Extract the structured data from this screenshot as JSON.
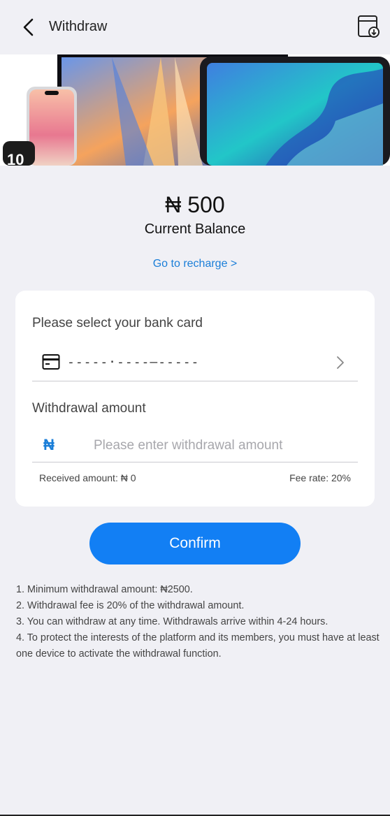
{
  "header": {
    "title": "Withdraw"
  },
  "balance": {
    "amount": "₦ 500",
    "label": "Current Balance"
  },
  "recharge_link": "Go to recharge >",
  "bank": {
    "section_label": "Please select your bank card",
    "card_number_masked": "-----·----—-----"
  },
  "withdrawal": {
    "section_label": "Withdrawal amount",
    "currency_symbol": "₦",
    "input_value": "",
    "input_placeholder": "Please enter withdrawal amount",
    "received_amount": "Received amount: ₦ 0",
    "fee_rate": "Fee rate: 20%"
  },
  "confirm_label": "Confirm",
  "notes": [
    "1. Minimum withdrawal amount: ₦2500.",
    "2. Withdrawal fee is 20% of the withdrawal amount.",
    "3. You can withdraw at any time. Withdrawals arrive within 4-24 hours.",
    "4. To protect the interests of the platform and its members, you must have at least one device to activate the withdrawal function."
  ],
  "icons": {
    "back": "chevron-left-icon",
    "record": "withdraw-record-icon",
    "bank_card": "bank-card-icon",
    "chevron": "chevron-right-icon"
  },
  "colors": {
    "accent": "#127ff4",
    "link": "#1a7ed8",
    "background": "#f0f0f5"
  }
}
